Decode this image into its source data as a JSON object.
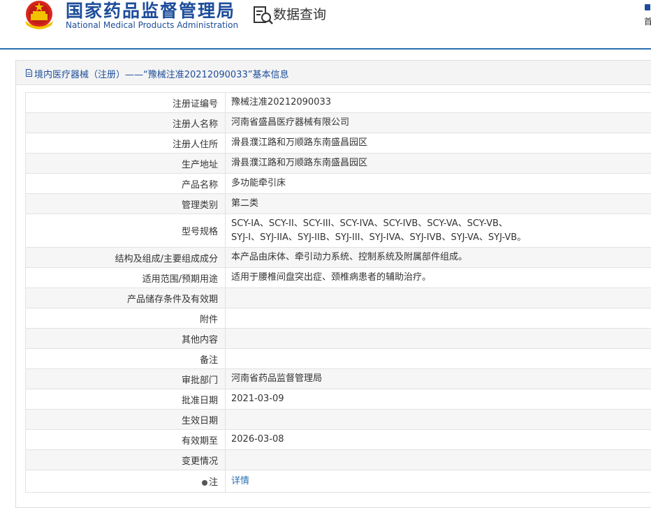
{
  "header": {
    "logo_cn": "国家药品监督管理局",
    "logo_en": "National Medical Products Administration",
    "query_title": "数据查询",
    "top_right_text": "首"
  },
  "panel": {
    "title": "境内医疗器械（注册）——“豫械注准20212090033”基本信息"
  },
  "rows": [
    {
      "label": "注册证编号",
      "value": "豫械注准20212090033"
    },
    {
      "label": "注册人名称",
      "value": "河南省盛昌医疗器械有限公司"
    },
    {
      "label": "注册人住所",
      "value": "滑县濮江路和万顺路东南盛昌园区"
    },
    {
      "label": "生产地址",
      "value": "滑县濮江路和万顺路东南盛昌园区"
    },
    {
      "label": "产品名称",
      "value": "多功能牵引床"
    },
    {
      "label": "管理类别",
      "value": "第二类"
    },
    {
      "label": "型号规格",
      "value": "SCY-IA、SCY-II、SCY-III、SCY-IVA、SCY-IVB、SCY-VA、SCY-VB、",
      "value2": "SYJ-I、SYJ-IIA、SYJ-IIB、SYJ-III、SYJ-IVA、SYJ-IVB、SYJ-VA、SYJ-VB。"
    },
    {
      "label": "结构及组成/主要组成成分",
      "value": "本产品由床体、牵引动力系统、控制系统及附属部件组成。"
    },
    {
      "label": "适用范围/预期用途",
      "value": "适用于腰椎间盘突出症、颈椎病患者的辅助治疗。"
    },
    {
      "label": "产品储存条件及有效期",
      "value": ""
    },
    {
      "label": "附件",
      "value": ""
    },
    {
      "label": "其他内容",
      "value": ""
    },
    {
      "label": "备注",
      "value": ""
    },
    {
      "label": "审批部门",
      "value": "河南省药品监督管理局"
    },
    {
      "label": "批准日期",
      "value": "2021-03-09"
    },
    {
      "label": "生效日期",
      "value": ""
    },
    {
      "label": "有效期至",
      "value": "2026-03-08"
    },
    {
      "label": "变更情况",
      "value": ""
    },
    {
      "label": "注",
      "value": "详情"
    }
  ]
}
